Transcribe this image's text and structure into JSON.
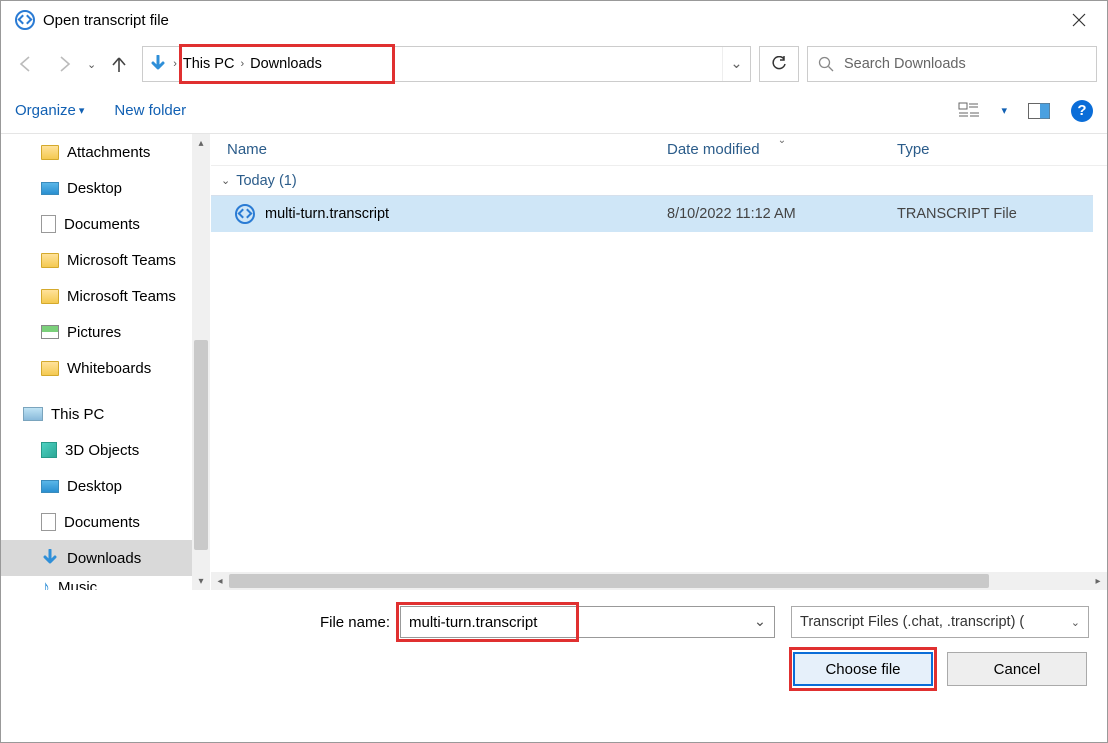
{
  "window": {
    "title": "Open transcript file"
  },
  "nav": {
    "breadcrumbs": [
      "This PC",
      "Downloads"
    ],
    "search_placeholder": "Search Downloads"
  },
  "toolbar": {
    "organize": "Organize",
    "new_folder": "New folder"
  },
  "sidebar": {
    "items": [
      {
        "label": "Attachments",
        "icon": "folder"
      },
      {
        "label": "Desktop",
        "icon": "monitor"
      },
      {
        "label": "Documents",
        "icon": "doc"
      },
      {
        "label": "Microsoft Teams",
        "icon": "folder"
      },
      {
        "label": "Microsoft Teams",
        "icon": "folder"
      },
      {
        "label": "Pictures",
        "icon": "pic"
      },
      {
        "label": "Whiteboards",
        "icon": "folder"
      }
    ],
    "this_pc": "This PC",
    "pc_items": [
      {
        "label": "3D Objects",
        "icon": "cube"
      },
      {
        "label": "Desktop",
        "icon": "monitor"
      },
      {
        "label": "Documents",
        "icon": "doc"
      },
      {
        "label": "Downloads",
        "icon": "download",
        "selected": true
      },
      {
        "label": "Music",
        "icon": "music"
      }
    ]
  },
  "columns": {
    "name": "Name",
    "date": "Date modified",
    "type": "Type"
  },
  "group": {
    "label": "Today (1)"
  },
  "files": [
    {
      "name": "multi-turn.transcript",
      "date": "8/10/2022 11:12 AM",
      "type": "TRANSCRIPT File"
    }
  ],
  "footer": {
    "filename_label": "File name:",
    "filename_value": "multi-turn.transcript",
    "filter": "Transcript Files (.chat, .transcript) (",
    "choose": "Choose file",
    "cancel": "Cancel"
  }
}
